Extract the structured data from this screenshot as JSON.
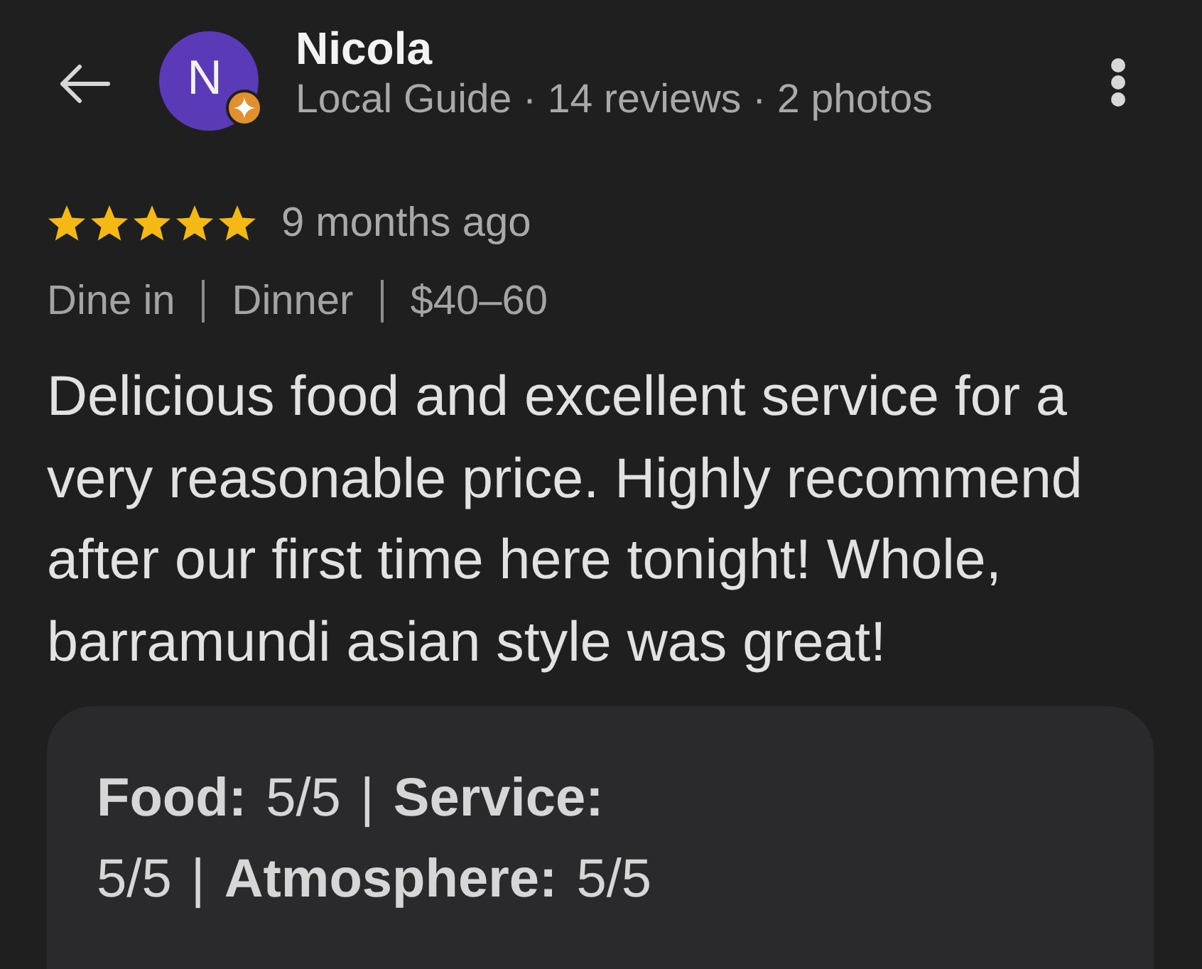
{
  "header": {
    "avatar_initial": "N",
    "name": "Nicola",
    "subtitle": "Local Guide · 14 reviews · 2 photos"
  },
  "review": {
    "stars": 5,
    "time": "9 months ago",
    "details": [
      "Dine in",
      "Dinner",
      "$40–60"
    ],
    "text": "Delicious food and excellent service for a very reasonable price. Highly recommend after our first time here tonight! Whole, barramundi asian style was great!",
    "ratings": "**Food:** 5/5 | **Service:** 5/5 | **Atmosphere:** 5/5"
  }
}
